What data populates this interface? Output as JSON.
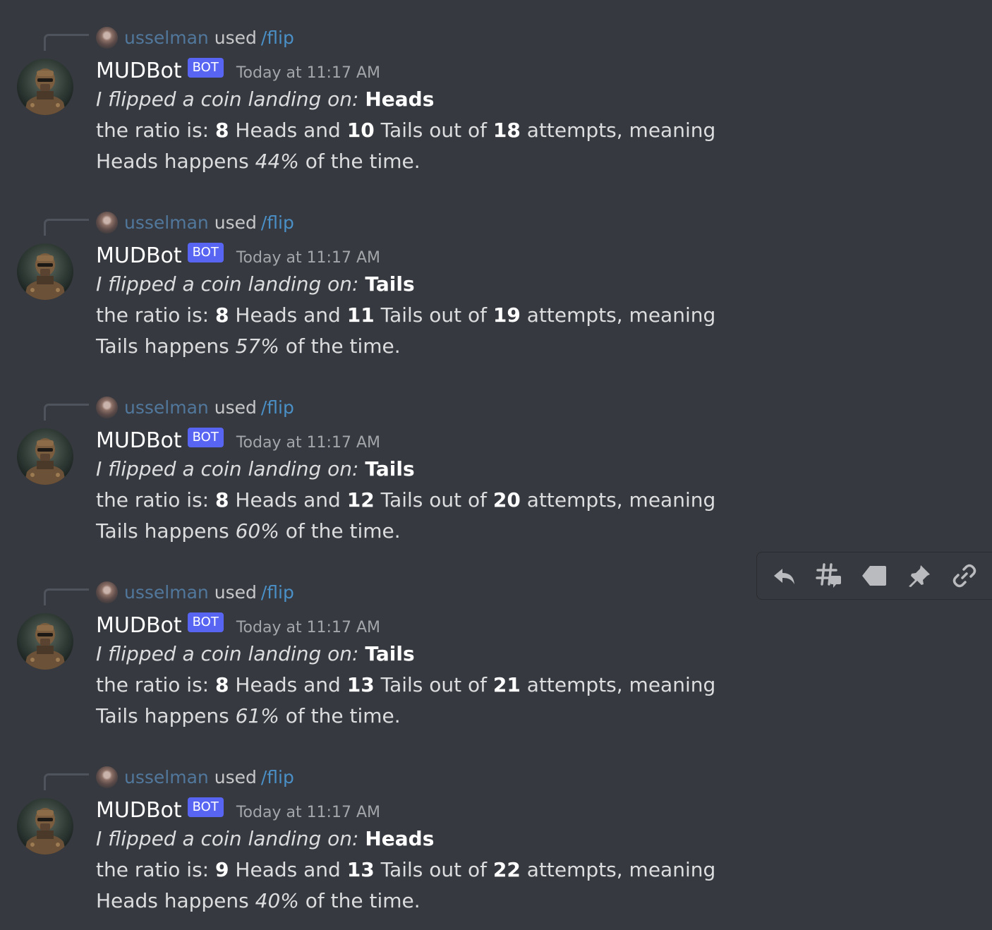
{
  "messages": [
    {
      "reply": {
        "user": "usselman",
        "used": "used",
        "command": "/flip"
      },
      "author": "MUDBot",
      "tag": "BOT",
      "timestamp": "Today at 11:17 AM",
      "line1": {
        "prefix": "I flipped a coin landing on:",
        "result": "Heads"
      },
      "ratio": {
        "lead": "the ratio is:",
        "heads": "8",
        "heads_text": "Heads and",
        "tails": "10",
        "tails_text": "Tails out of",
        "attempts": "18",
        "tail": "attempts, meaning"
      },
      "summary": {
        "side": "Heads happens",
        "percent": "44%",
        "tail": "of the time."
      }
    },
    {
      "reply": {
        "user": "usselman",
        "used": "used",
        "command": "/flip"
      },
      "author": "MUDBot",
      "tag": "BOT",
      "timestamp": "Today at 11:17 AM",
      "line1": {
        "prefix": "I flipped a coin landing on:",
        "result": "Tails"
      },
      "ratio": {
        "lead": "the ratio is:",
        "heads": "8",
        "heads_text": "Heads and",
        "tails": "11",
        "tails_text": "Tails out of",
        "attempts": "19",
        "tail": "attempts, meaning"
      },
      "summary": {
        "side": "Tails happens",
        "percent": "57%",
        "tail": "of the time."
      }
    },
    {
      "reply": {
        "user": "usselman",
        "used": "used",
        "command": "/flip"
      },
      "author": "MUDBot",
      "tag": "BOT",
      "timestamp": "Today at 11:17 AM",
      "line1": {
        "prefix": "I flipped a coin landing on:",
        "result": "Tails"
      },
      "ratio": {
        "lead": "the ratio is:",
        "heads": "8",
        "heads_text": "Heads and",
        "tails": "12",
        "tails_text": "Tails out of",
        "attempts": "20",
        "tail": "attempts, meaning"
      },
      "summary": {
        "side": "Tails happens",
        "percent": "60%",
        "tail": "of the time."
      }
    },
    {
      "reply": {
        "user": "usselman",
        "used": "used",
        "command": "/flip"
      },
      "author": "MUDBot",
      "tag": "BOT",
      "timestamp": "Today at 11:17 AM",
      "line1": {
        "prefix": "I flipped a coin landing on:",
        "result": "Tails"
      },
      "ratio": {
        "lead": "the ratio is:",
        "heads": "8",
        "heads_text": "Heads and",
        "tails": "13",
        "tails_text": "Tails out of",
        "attempts": "21",
        "tail": "attempts, meaning"
      },
      "summary": {
        "side": "Tails happens",
        "percent": "61%",
        "tail": "of the time."
      }
    },
    {
      "reply": {
        "user": "usselman",
        "used": "used",
        "command": "/flip"
      },
      "author": "MUDBot",
      "tag": "BOT",
      "timestamp": "Today at 11:17 AM",
      "line1": {
        "prefix": "I flipped a coin landing on:",
        "result": "Heads"
      },
      "ratio": {
        "lead": "the ratio is:",
        "heads": "9",
        "heads_text": "Heads and",
        "tails": "13",
        "tails_text": "Tails out of",
        "attempts": "22",
        "tail": "attempts, meaning"
      },
      "summary": {
        "side": "Heads happens",
        "percent": "40%",
        "tail": "of the time."
      }
    }
  ],
  "toolbar": {
    "icons": [
      "reply-icon",
      "create-thread-icon",
      "mark-unread-icon",
      "pin-icon",
      "copy-link-icon"
    ]
  }
}
